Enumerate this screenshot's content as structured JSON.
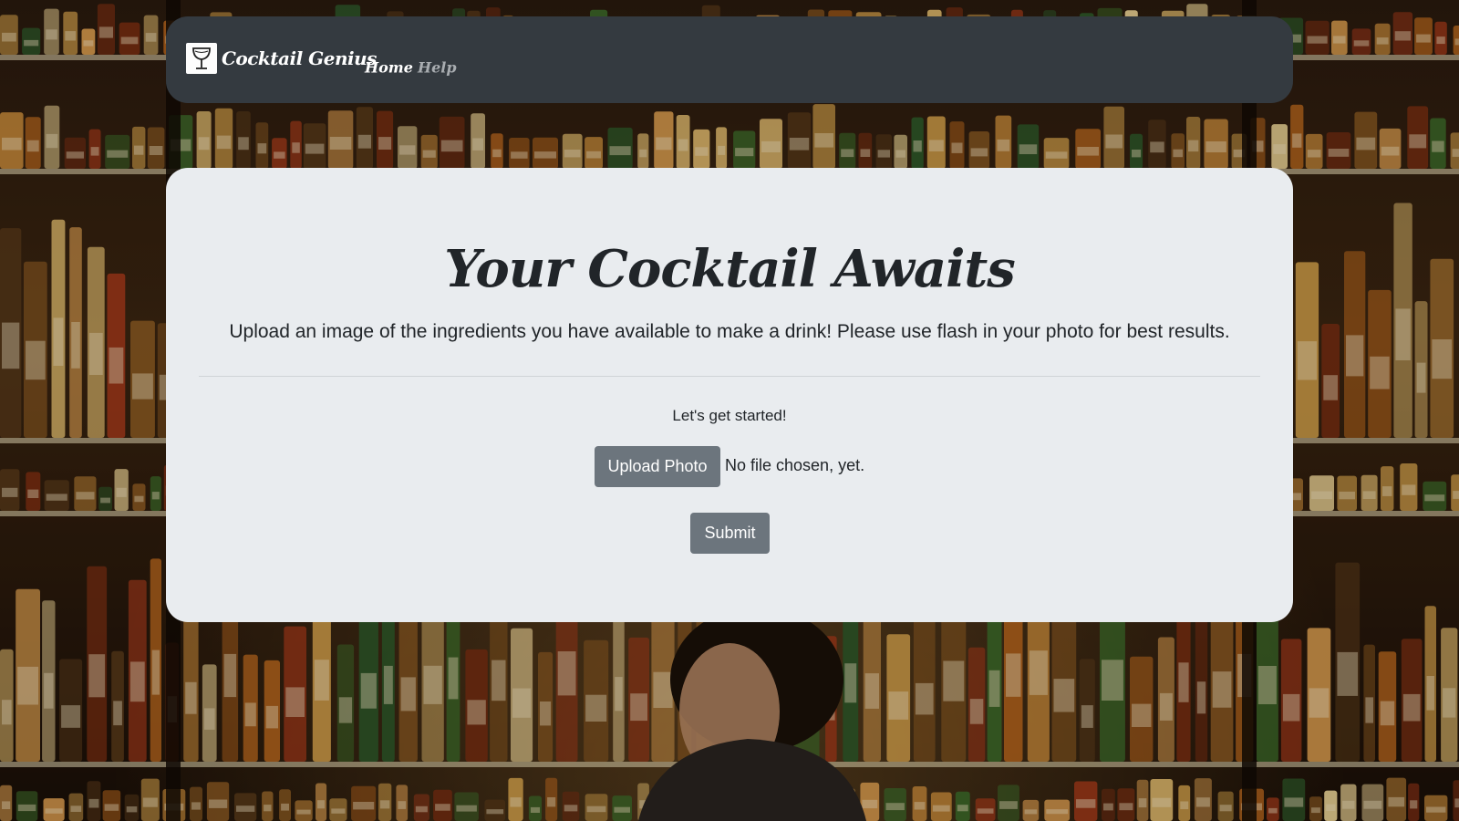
{
  "app": {
    "brand_name": "Cocktail Genius",
    "logo_icon": "wine-glass-icon"
  },
  "nav": {
    "items": [
      {
        "label": "Home",
        "active": true
      },
      {
        "label": "Help",
        "active": false
      }
    ]
  },
  "main": {
    "title": "Your Cocktail Awaits",
    "lead": "Upload an image of the ingredients you have available to make a drink! Please use flash in your photo for best results.",
    "prompt": "Let's get started!",
    "upload_label": "Upload Photo",
    "file_status": "No file chosen, yet.",
    "submit_label": "Submit"
  },
  "colors": {
    "navbar_bg": "#343a40",
    "card_bg": "#e9ecef",
    "button_bg": "#6c757d",
    "text": "#212529"
  }
}
